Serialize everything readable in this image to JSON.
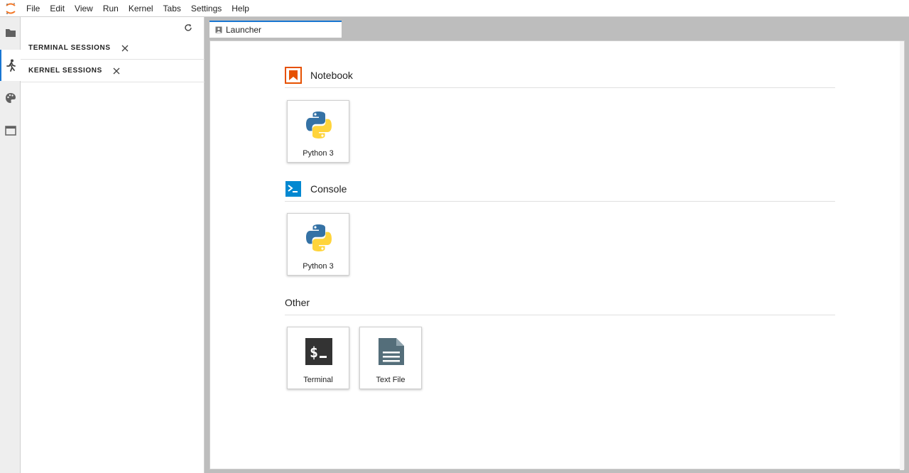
{
  "menubar": {
    "items": [
      "File",
      "Edit",
      "View",
      "Run",
      "Kernel",
      "Tabs",
      "Settings",
      "Help"
    ]
  },
  "activitybar": {
    "icons": [
      "folder-icon",
      "running-icon",
      "palette-icon",
      "tabs-icon"
    ],
    "active": "running-icon"
  },
  "sidepanel": {
    "refresh_icon": "refresh-icon",
    "sections": [
      {
        "title": "TERMINAL SESSIONS"
      },
      {
        "title": "KERNEL SESSIONS"
      }
    ]
  },
  "tabs": [
    {
      "label": "Launcher",
      "icon": "launcher-icon"
    }
  ],
  "launcher": {
    "sections": [
      {
        "title": "Notebook",
        "icon": "notebook-icon",
        "cards": [
          {
            "label": "Python 3",
            "icon": "python-icon"
          }
        ]
      },
      {
        "title": "Console",
        "icon": "console-icon",
        "cards": [
          {
            "label": "Python 3",
            "icon": "python-icon"
          }
        ]
      },
      {
        "title": "Other",
        "icon": "",
        "cards": [
          {
            "label": "Terminal",
            "icon": "terminal-icon"
          },
          {
            "label": "Text File",
            "icon": "text-file-icon"
          }
        ]
      }
    ]
  },
  "colors": {
    "accent": "#1976d2",
    "notebook": "#e65100",
    "console": "#0288d1",
    "terminal": "#333333",
    "textfile": "#546e7a",
    "python_blue": "#3572a5",
    "python_yellow": "#ffd43b"
  }
}
